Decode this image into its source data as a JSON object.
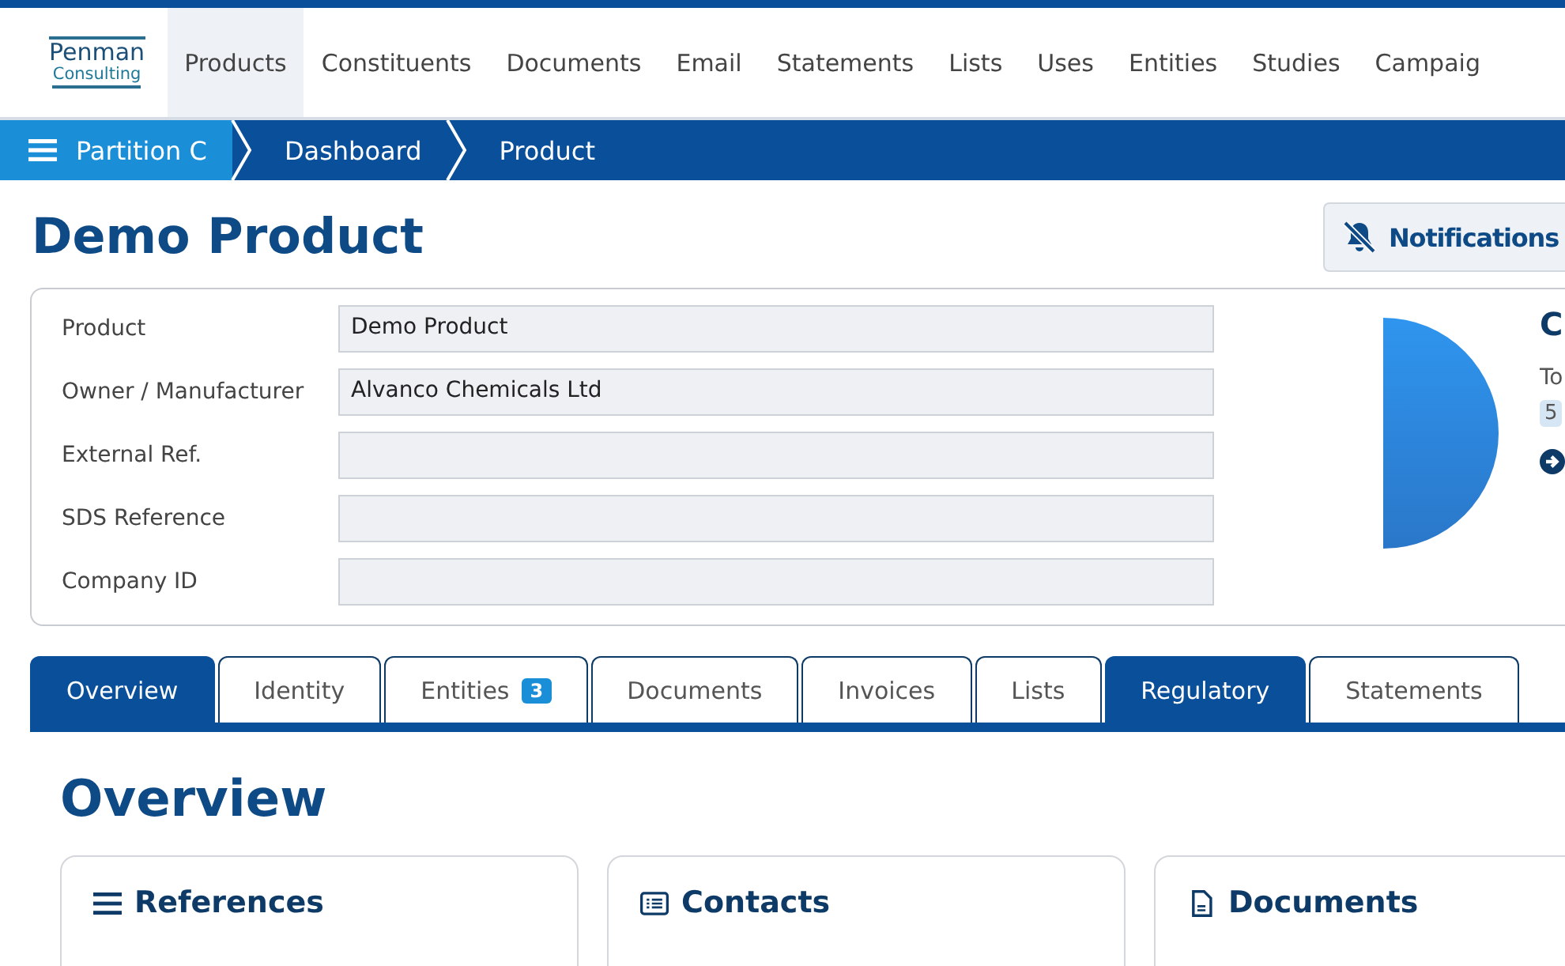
{
  "logo": {
    "line_1": "Penman",
    "line_2": "Consulting"
  },
  "nav": [
    {
      "label": "Products",
      "selected": true
    },
    {
      "label": "Constituents",
      "selected": false
    },
    {
      "label": "Documents",
      "selected": false
    },
    {
      "label": "Email",
      "selected": false
    },
    {
      "label": "Statements",
      "selected": false
    },
    {
      "label": "Lists",
      "selected": false
    },
    {
      "label": "Uses",
      "selected": false
    },
    {
      "label": "Entities",
      "selected": false
    },
    {
      "label": "Studies",
      "selected": false
    },
    {
      "label": "Campaig",
      "selected": false
    }
  ],
  "breadcrumb": [
    "Partition C",
    "Dashboard",
    "Product"
  ],
  "page_title": "Demo Product",
  "notifications_button": "Notifications",
  "fields": [
    {
      "label": "Product",
      "value": "Demo Product"
    },
    {
      "label": "Owner / Manufacturer",
      "value": "Alvanco Chemicals Ltd"
    },
    {
      "label": "External Ref."
    },
    {
      "label": "SDS Reference"
    },
    {
      "label": "Company ID"
    }
  ],
  "side_panel": {
    "heading": "C",
    "label": "To",
    "badge": "5"
  },
  "tabs": [
    {
      "label": "Overview",
      "selected": true
    },
    {
      "label": "Identity",
      "selected": false
    },
    {
      "label": "Entities",
      "badge": "3",
      "selected": false
    },
    {
      "label": "Documents",
      "selected": false
    },
    {
      "label": "Invoices",
      "selected": false
    },
    {
      "label": "Lists",
      "selected": false
    },
    {
      "label": "Regulatory",
      "selected": true
    },
    {
      "label": "Statements",
      "selected": false
    }
  ],
  "section_title": "Overview",
  "cards": [
    {
      "title": "References"
    },
    {
      "title": "Contacts"
    },
    {
      "title": "Documents"
    }
  ]
}
